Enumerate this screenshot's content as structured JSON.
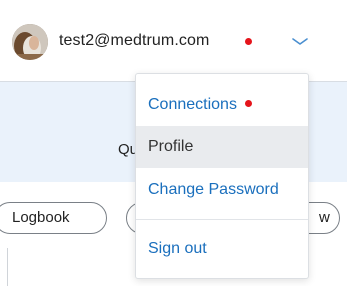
{
  "header": {
    "user_email": "test2@medtrum.com",
    "avatar_icon": "avatar-photo",
    "notification_color": "#e5141b",
    "chevron_icon": "chevron-down-icon",
    "chevron_color": "#4a8fd0"
  },
  "band": {
    "partial_text": "Qu"
  },
  "buttons": {
    "logbook_label": "Logbook",
    "right_partial_label": "w"
  },
  "menu": {
    "items": [
      {
        "label": "Connections",
        "has_notification_dot": true,
        "active": false
      },
      {
        "label": "Profile",
        "active": true
      },
      {
        "label": "Change Password",
        "active": false
      },
      {
        "label": "Sign out",
        "active": false
      }
    ]
  },
  "colors": {
    "link_blue": "#1a6fbd",
    "band_bg": "#eaf2fb",
    "active_item_bg": "#e9ebee",
    "alert_red": "#e5141b"
  }
}
